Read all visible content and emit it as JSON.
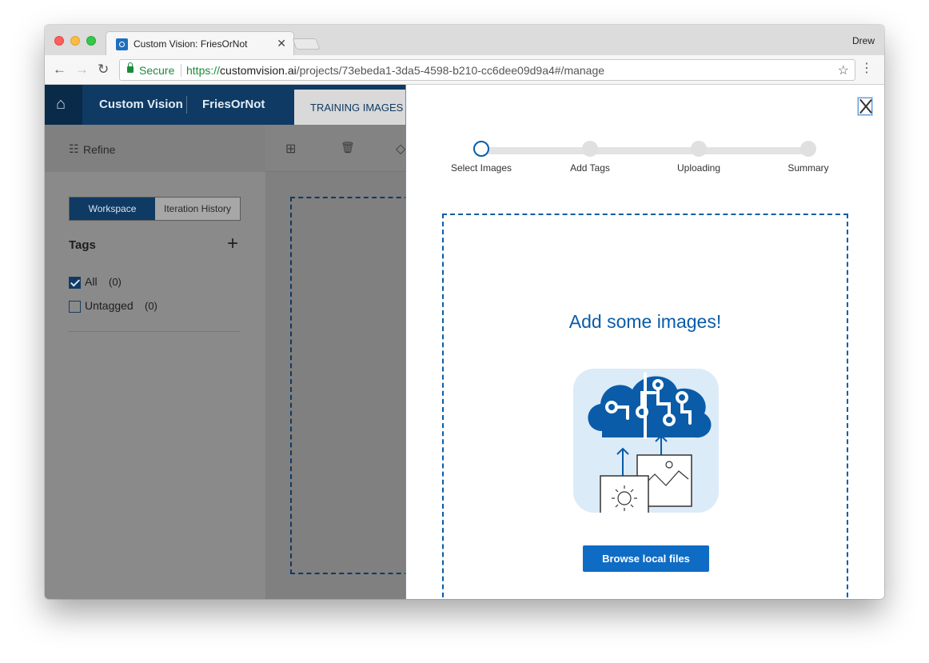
{
  "browser": {
    "tab_title": "Custom Vision: FriesOrNot",
    "tab_close": "✕",
    "profile": "Drew",
    "secure_label": "Secure",
    "url_scheme": "https://",
    "url_host": "customvision.ai",
    "url_path": "/projects/73ebeda1-3da5-4598-b210-cc6dee09d9a4#/manage",
    "icons": {
      "back": "←",
      "forward": "→",
      "reload": "↻",
      "star": "☆",
      "menu": "⋮"
    }
  },
  "app": {
    "brand": "Custom Vision",
    "project": "FriesOrNot",
    "active_tab": "TRAINING IMAGES",
    "home_icon": "⌂"
  },
  "sidebar": {
    "refine_icon": "☷",
    "refine_label": "Refine",
    "segments": [
      "Workspace",
      "Iteration History"
    ],
    "tags_title": "Tags",
    "tags_add": "+",
    "tags": [
      {
        "label": "All",
        "count": "(0)",
        "checked": true
      },
      {
        "label": "Untagged",
        "count": "(0)",
        "checked": false
      }
    ]
  },
  "main_toolbar": {
    "add_icon": "⊞",
    "delete_icon": "🗑",
    "tag_icon": "◇"
  },
  "upload_panel": {
    "steps": [
      "Select Images",
      "Add Tags",
      "Uploading",
      "Summary"
    ],
    "active_step": 0,
    "title": "Add some images!",
    "browse_label": "Browse local files"
  },
  "colors": {
    "brand_dark": "#0f3a63",
    "accent": "#0a5ca8",
    "button": "#0f6cc5",
    "secure_green": "#1b8b3a"
  }
}
